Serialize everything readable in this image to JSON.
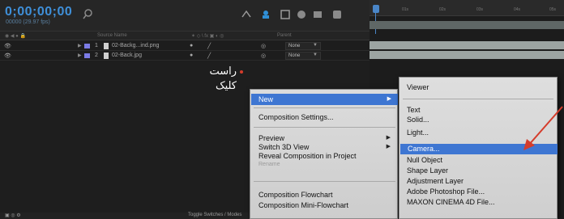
{
  "timeline": {
    "timecode": "0;00;00;00",
    "frames": "00000 (29.97 fps)",
    "columns": {
      "source_name": "Source Name",
      "parent": "Parent"
    },
    "layers": [
      {
        "number": "1",
        "name": "02-Backg...ind.png",
        "mode": "None"
      },
      {
        "number": "2",
        "name": "02-Back.jpg",
        "mode": "None"
      }
    ],
    "footer": {
      "toggle_label": "Toggle Switches / Modes"
    }
  },
  "ruler": {
    "ticks": [
      "01s",
      "02s",
      "03s",
      "04s",
      "05s"
    ]
  },
  "annotation": {
    "line1": "راست",
    "line2": "کلیک"
  },
  "context_menu": {
    "items": [
      {
        "label": "New",
        "submenu": true,
        "highlighted": true
      },
      {
        "label": "Composition Settings..."
      },
      {
        "label": "Preview",
        "submenu": true
      },
      {
        "label": "Switch 3D View",
        "submenu": true
      },
      {
        "label": "Reveal Composition in Project"
      },
      {
        "label": "Rename",
        "disabled": true
      },
      {
        "label": "Composition Flowchart"
      },
      {
        "label": "Composition Mini-Flowchart"
      }
    ]
  },
  "submenu": {
    "items": [
      {
        "label": "Viewer"
      },
      {
        "label": "Text"
      },
      {
        "label": "Solid..."
      },
      {
        "label": "Light..."
      },
      {
        "label": "Camera...",
        "highlighted": true
      },
      {
        "label": "Null Object"
      },
      {
        "label": "Shape Layer"
      },
      {
        "label": "Adjustment Layer"
      },
      {
        "label": "Adobe Photoshop File..."
      },
      {
        "label": "MAXON CINEMA 4D File..."
      }
    ]
  },
  "colors": {
    "timecode": "#3f8fd8",
    "highlight": "#3e76d2",
    "label_chip": "#7c7ce6",
    "annotation_arrow": "#d53c2b"
  }
}
